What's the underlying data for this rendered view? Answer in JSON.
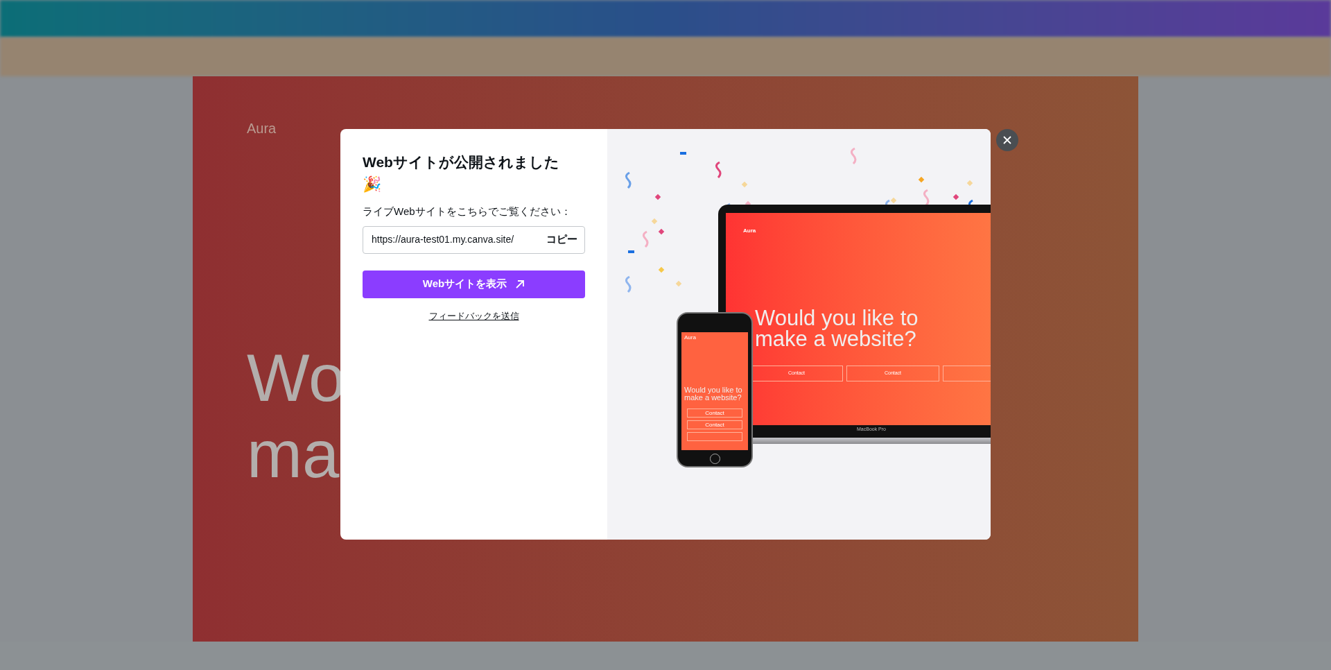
{
  "background": {
    "brand": "Aura",
    "heading_lines": [
      "Wo",
      "ma"
    ]
  },
  "dialog": {
    "title": "Webサイトが公開されました",
    "emoji": "🎉",
    "label": "ライブWebサイトをこちらでご覧ください：",
    "url": "https://aura-test01.my.canva.site/",
    "copy": "コピー",
    "primary": "Webサイトを表示",
    "feedback": "フィードバックを送信"
  },
  "mockup": {
    "laptop": {
      "brand": "Aura",
      "heading": "Would you like to make a website?",
      "buttons": [
        "Contact",
        "Contact"
      ],
      "model": "MacBook Pro"
    },
    "phone": {
      "brand": "Aura",
      "heading": "Would you like to make a website?",
      "buttons": [
        "Contact",
        "Contact"
      ]
    }
  }
}
